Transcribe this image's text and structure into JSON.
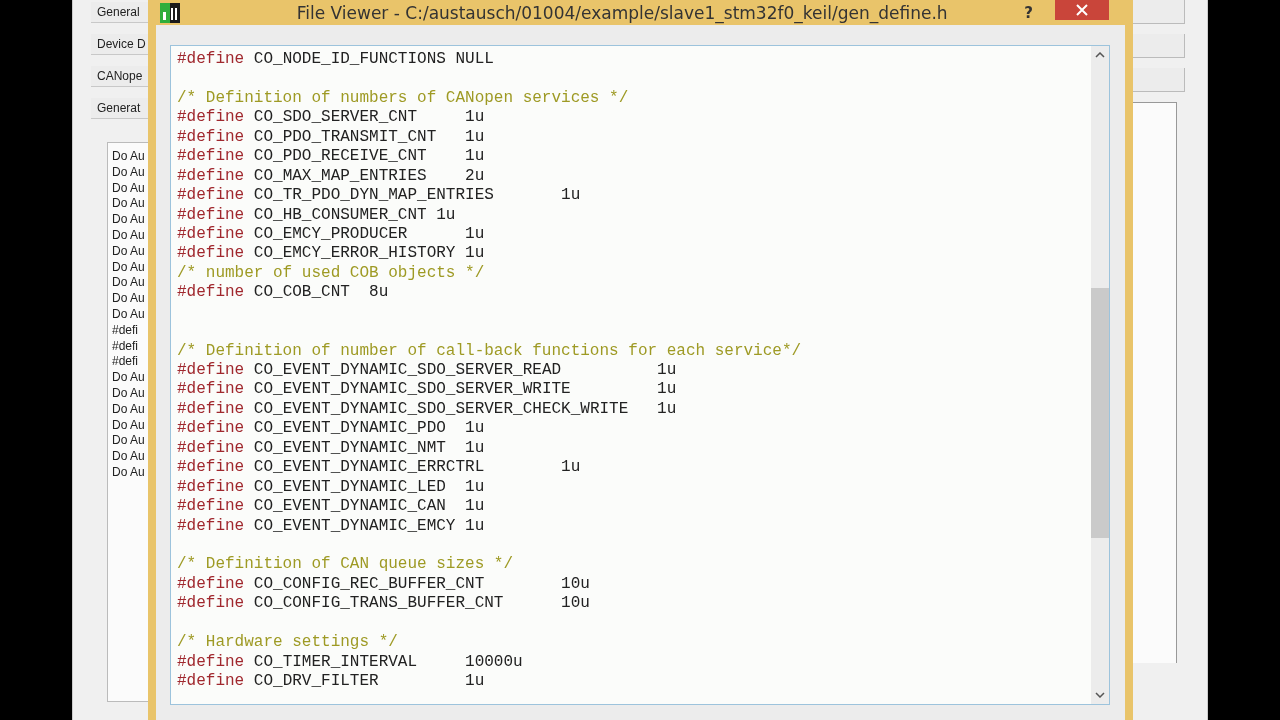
{
  "background_window": {
    "buttons": [
      "General",
      "Device D",
      "CANope",
      "Generat"
    ],
    "log_items": [
      "Do Au",
      "Do Au",
      "Do Au",
      "Do Au",
      "Do Au",
      "Do Au",
      "Do Au",
      "Do Au",
      "Do Au",
      "Do Au",
      "Do Au",
      "#defi",
      "#defi",
      "#defi",
      "Do Au",
      "Do Au",
      "Do Au",
      "Do Au",
      "Do Au",
      "Do Au",
      "Do Au"
    ]
  },
  "dialog": {
    "title": "File Viewer - C:/austausch/01004/example/slave1_stm32f0_keil/gen_define.h",
    "help": "?",
    "lines": [
      {
        "kind": "define",
        "keyword": "#define",
        "name": "CO_NODE_ID_FUNCTIONS ",
        "value": "NULL"
      },
      {
        "kind": "blank"
      },
      {
        "kind": "comment",
        "text": "/* Definition of numbers of CANopen services */"
      },
      {
        "kind": "define",
        "keyword": "#define",
        "name": "CO_SDO_SERVER_CNT     ",
        "value": "1u"
      },
      {
        "kind": "define",
        "keyword": "#define",
        "name": "CO_PDO_TRANSMIT_CNT   ",
        "value": "1u"
      },
      {
        "kind": "define",
        "keyword": "#define",
        "name": "CO_PDO_RECEIVE_CNT    ",
        "value": "1u"
      },
      {
        "kind": "define",
        "keyword": "#define",
        "name": "CO_MAX_MAP_ENTRIES    ",
        "value": "2u"
      },
      {
        "kind": "define",
        "keyword": "#define",
        "name": "CO_TR_PDO_DYN_MAP_ENTRIES       ",
        "value": "1u"
      },
      {
        "kind": "define",
        "keyword": "#define",
        "name": "CO_HB_CONSUMER_CNT ",
        "value": "1u"
      },
      {
        "kind": "define",
        "keyword": "#define",
        "name": "CO_EMCY_PRODUCER      ",
        "value": "1u"
      },
      {
        "kind": "define",
        "keyword": "#define",
        "name": "CO_EMCY_ERROR_HISTORY ",
        "value": "1u"
      },
      {
        "kind": "comment",
        "text": "/* number of used COB objects */"
      },
      {
        "kind": "define",
        "keyword": "#define",
        "name": "CO_COB_CNT  ",
        "value": "8u"
      },
      {
        "kind": "blank"
      },
      {
        "kind": "blank"
      },
      {
        "kind": "comment",
        "text": "/* Definition of number of call-back functions for each service*/"
      },
      {
        "kind": "define",
        "keyword": "#define",
        "name": "CO_EVENT_DYNAMIC_SDO_SERVER_READ          ",
        "value": "1u"
      },
      {
        "kind": "define",
        "keyword": "#define",
        "name": "CO_EVENT_DYNAMIC_SDO_SERVER_WRITE         ",
        "value": "1u"
      },
      {
        "kind": "define",
        "keyword": "#define",
        "name": "CO_EVENT_DYNAMIC_SDO_SERVER_CHECK_WRITE   ",
        "value": "1u"
      },
      {
        "kind": "define",
        "keyword": "#define",
        "name": "CO_EVENT_DYNAMIC_PDO  ",
        "value": "1u"
      },
      {
        "kind": "define",
        "keyword": "#define",
        "name": "CO_EVENT_DYNAMIC_NMT  ",
        "value": "1u"
      },
      {
        "kind": "define",
        "keyword": "#define",
        "name": "CO_EVENT_DYNAMIC_ERRCTRL        ",
        "value": "1u"
      },
      {
        "kind": "define",
        "keyword": "#define",
        "name": "CO_EVENT_DYNAMIC_LED  ",
        "value": "1u"
      },
      {
        "kind": "define",
        "keyword": "#define",
        "name": "CO_EVENT_DYNAMIC_CAN  ",
        "value": "1u"
      },
      {
        "kind": "define",
        "keyword": "#define",
        "name": "CO_EVENT_DYNAMIC_EMCY ",
        "value": "1u"
      },
      {
        "kind": "blank"
      },
      {
        "kind": "comment",
        "text": "/* Definition of CAN queue sizes */"
      },
      {
        "kind": "define",
        "keyword": "#define",
        "name": "CO_CONFIG_REC_BUFFER_CNT        ",
        "value": "10u"
      },
      {
        "kind": "define",
        "keyword": "#define",
        "name": "CO_CONFIG_TRANS_BUFFER_CNT      ",
        "value": "10u"
      },
      {
        "kind": "blank"
      },
      {
        "kind": "comment",
        "text": "/* Hardware settings */"
      },
      {
        "kind": "define",
        "keyword": "#define",
        "name": "CO_TIMER_INTERVAL     ",
        "value": "10000u"
      },
      {
        "kind": "define",
        "keyword": "#define",
        "name": "CO_DRV_FILTER         ",
        "value": "1u"
      }
    ]
  }
}
